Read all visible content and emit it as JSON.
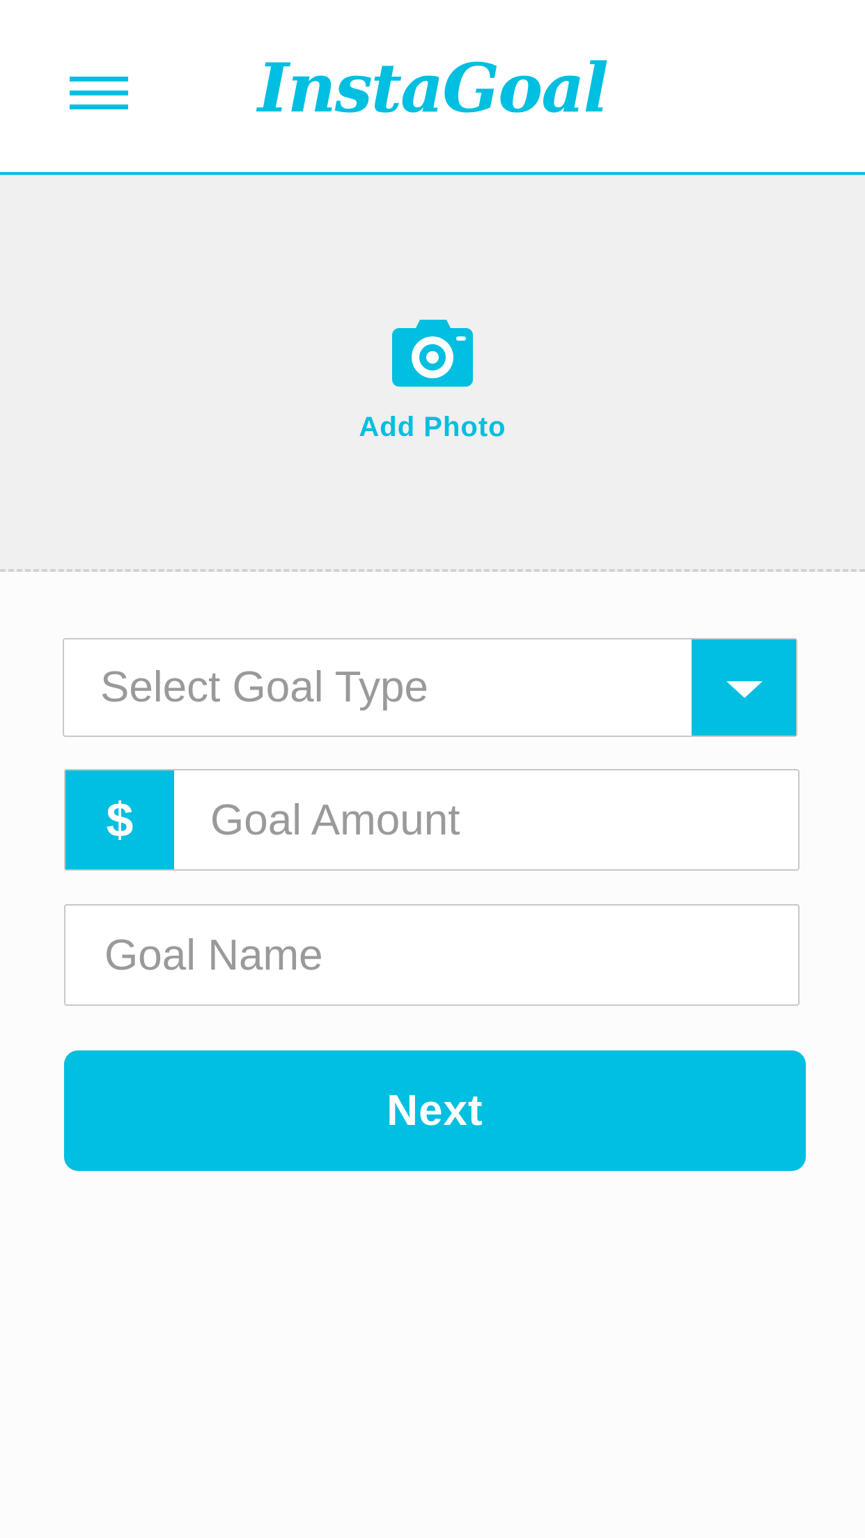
{
  "app": {
    "title": "InstaGoal"
  },
  "header": {
    "menu_icon": "hamburger-menu-icon"
  },
  "photo": {
    "icon": "camera-icon",
    "label": "Add Photo"
  },
  "form": {
    "goal_type": {
      "placeholder": "Select Goal Type",
      "icon": "chevron-down-icon"
    },
    "goal_amount": {
      "prefix": "$",
      "placeholder": "Goal Amount",
      "value": ""
    },
    "goal_name": {
      "placeholder": "Goal Name",
      "value": ""
    },
    "next_label": "Next"
  },
  "colors": {
    "accent": "#00bfe0",
    "placeholder_text": "#9a9a9a",
    "photo_area_bg": "#f0f0f0",
    "border": "#c8c8c8"
  }
}
